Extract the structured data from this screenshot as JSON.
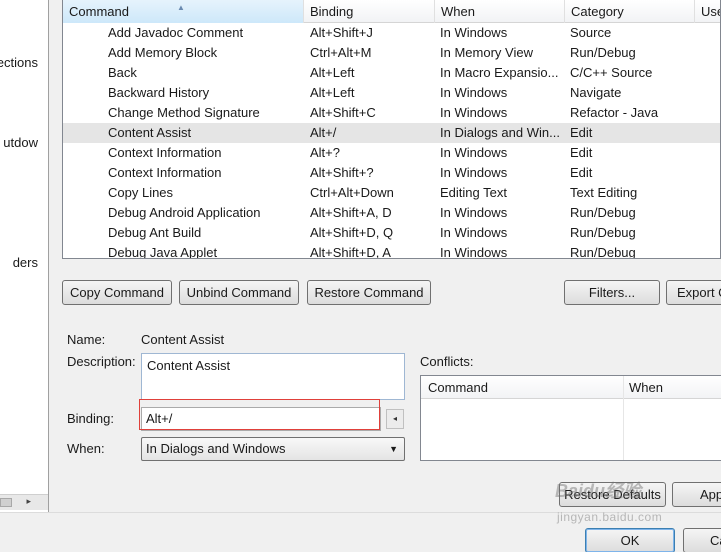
{
  "left_pane": {
    "items": [
      "ections",
      "utdow",
      "ders"
    ]
  },
  "table": {
    "columns": [
      "Command",
      "Binding",
      "When",
      "Category",
      "Use"
    ],
    "rows": [
      {
        "command": "Add Javadoc Comment",
        "binding": "Alt+Shift+J",
        "when": "In Windows",
        "category": "Source"
      },
      {
        "command": "Add Memory Block",
        "binding": "Ctrl+Alt+M",
        "when": "In Memory View",
        "category": "Run/Debug"
      },
      {
        "command": "Back",
        "binding": "Alt+Left",
        "when": "In Macro Expansio...",
        "category": "C/C++ Source"
      },
      {
        "command": "Backward History",
        "binding": "Alt+Left",
        "when": "In Windows",
        "category": "Navigate"
      },
      {
        "command": "Change Method Signature",
        "binding": "Alt+Shift+C",
        "when": "In Windows",
        "category": "Refactor - Java"
      },
      {
        "command": "Content Assist",
        "binding": "Alt+/",
        "when": "In Dialogs and Win...",
        "category": "Edit"
      },
      {
        "command": "Context Information",
        "binding": "Alt+?",
        "when": "In Windows",
        "category": "Edit"
      },
      {
        "command": "Context Information",
        "binding": "Alt+Shift+?",
        "when": "In Windows",
        "category": "Edit"
      },
      {
        "command": "Copy Lines",
        "binding": "Ctrl+Alt+Down",
        "when": "Editing Text",
        "category": "Text Editing"
      },
      {
        "command": "Debug Android Application",
        "binding": "Alt+Shift+A, D",
        "when": "In Windows",
        "category": "Run/Debug"
      },
      {
        "command": "Debug Ant Build",
        "binding": "Alt+Shift+D, Q",
        "when": "In Windows",
        "category": "Run/Debug"
      },
      {
        "command": "Debug Java Applet",
        "binding": "Alt+Shift+D, A",
        "when": "In Windows",
        "category": "Run/Debug"
      }
    ],
    "selected_index": 5
  },
  "buttons": {
    "copy_command": "Copy Command",
    "unbind_command": "Unbind Command",
    "restore_command": "Restore Command",
    "filters": "Filters...",
    "export": "Export C",
    "restore_defaults": "Restore Defaults",
    "apply": "App",
    "ok": "OK",
    "cancel": "Ca"
  },
  "details": {
    "name_label": "Name:",
    "name_value": "Content Assist",
    "description_label": "Description:",
    "description_value": "Content Assist",
    "binding_label": "Binding:",
    "binding_value": "Alt+/",
    "when_label": "When:",
    "when_value": "In Dialogs and Windows",
    "conflicts_label": "Conflicts:"
  },
  "conflicts": {
    "columns": [
      "Command",
      "When"
    ]
  },
  "watermark": {
    "text": "Baidu经验",
    "sub": "jingyan.baidu.com"
  },
  "colors": {
    "highlight_box": "#e0403a",
    "selected_row": "#e5e5e5",
    "focus_border": "#3c7fb1"
  }
}
